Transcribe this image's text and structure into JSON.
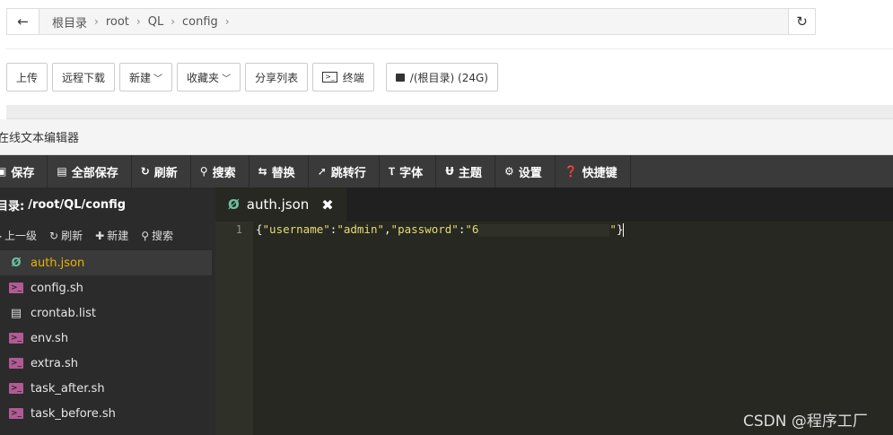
{
  "breadcrumb": {
    "back_icon": "←",
    "items": [
      "根目录",
      "root",
      "QL",
      "config"
    ],
    "separator": "›",
    "refresh_icon": "↻"
  },
  "toolbar": {
    "upload": "上传",
    "remote_download": "远程下载",
    "new": "新建",
    "favorites": "收藏夹",
    "share_list": "分享列表",
    "terminal": "终端",
    "disk": "/(根目录) (24G)"
  },
  "editor": {
    "title": "在线文本编辑器",
    "menu": {
      "save": "保存",
      "save_all": "全部保存",
      "refresh": "刷新",
      "search": "搜索",
      "replace": "替换",
      "goto_line": "跳转行",
      "font": "字体",
      "theme": "主题",
      "settings": "设置",
      "shortcuts": "快捷键"
    },
    "sidebar": {
      "path_label": "目录:",
      "path": "/root/QL/config",
      "actions": {
        "up": "上一级",
        "refresh": "刷新",
        "new": "新建",
        "search": "搜索"
      },
      "files": [
        {
          "name": "auth.json",
          "type": "json",
          "active": true
        },
        {
          "name": "config.sh",
          "type": "sh",
          "active": false
        },
        {
          "name": "crontab.list",
          "type": "list",
          "active": false
        },
        {
          "name": "env.sh",
          "type": "sh",
          "active": false
        },
        {
          "name": "extra.sh",
          "type": "sh",
          "active": false
        },
        {
          "name": "task_after.sh",
          "type": "sh",
          "active": false
        },
        {
          "name": "task_before.sh",
          "type": "sh",
          "active": false
        }
      ]
    },
    "tab": {
      "name": "auth.json",
      "close_icon": "✖"
    },
    "code": {
      "line_number": "1",
      "open_brace": "{",
      "key_username": "\"username\"",
      "colon1": ":",
      "val_username": "\"admin\"",
      "comma": ",",
      "key_password": "\"password\"",
      "colon2": ":",
      "val_password_start": "\"6",
      "val_password_end": "\"",
      "close_brace": "}"
    }
  },
  "watermark": "CSDN @程序工厂"
}
